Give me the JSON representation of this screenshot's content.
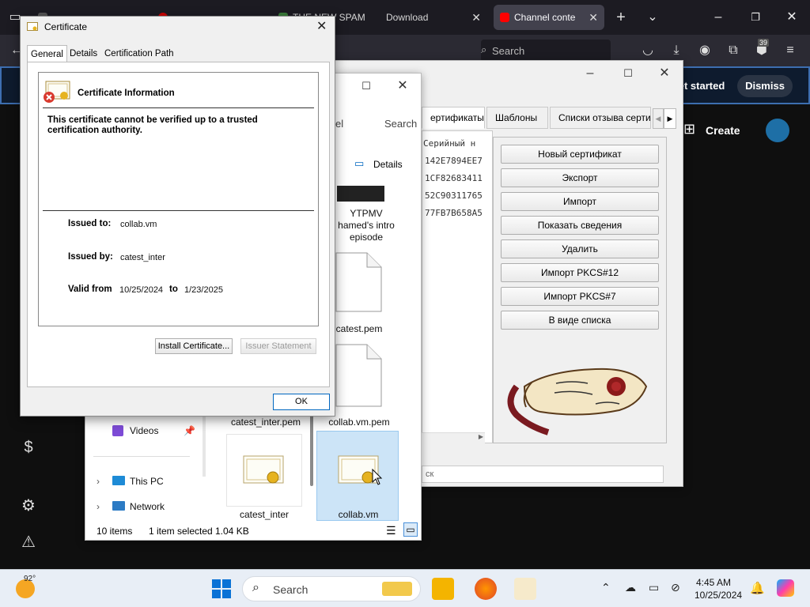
{
  "browser": {
    "tabs": [
      {
        "label": "",
        "active": false
      },
      {
        "label": "",
        "active": false
      },
      {
        "label": "THE NEW SPAM",
        "active": false
      },
      {
        "label": "Download",
        "active": false
      },
      {
        "label": "Channel conte",
        "active": true
      }
    ],
    "search_placeholder": "Search",
    "badge_count": "39"
  },
  "youtube": {
    "get_started_label": "et started",
    "dismiss_label": "Dismiss",
    "create_label": "Create"
  },
  "cert_manager": {
    "tabs": [
      "ертификаты",
      "Шаблоны",
      "Списки отзыва сертис"
    ],
    "serial_header": "Серийный н",
    "serials": [
      "142E7894EE7",
      "1CF82683411",
      "52C90311765",
      "77FB7B658A5"
    ],
    "buttons": [
      {
        "label": "Новый сертификат",
        "mnemonic": "Н"
      },
      {
        "label": "Экспорт",
        "mnemonic": "Э"
      },
      {
        "label": "Импорт",
        "mnemonic": "И"
      },
      {
        "label": "Показать сведения",
        "mnemonic": "П"
      },
      {
        "label": "Удалить",
        "mnemonic": "У"
      },
      {
        "label": "Импорт PKCS#12",
        "mnemonic": "P"
      },
      {
        "label": "Импорт PKCS#7",
        "mnemonic": "K"
      },
      {
        "label": "В виде списка",
        "mnemonic": "В"
      }
    ],
    "bottom_input_text": "ск"
  },
  "explorer": {
    "search_label": "Search",
    "partial_text": "el",
    "details_label": "Details",
    "items": [
      {
        "name": "YTPMV\nhamed's intro\nepisode"
      },
      {
        "name": "catest.pem"
      },
      {
        "name": "catest_inter.pem"
      },
      {
        "name": "collab.vm.pem"
      },
      {
        "name": "catest_inter"
      },
      {
        "name": "collab.vm"
      }
    ],
    "nav": [
      {
        "label": "Videos"
      },
      {
        "label": "This PC"
      },
      {
        "label": "Network"
      }
    ],
    "status": {
      "items": "10 items",
      "selected": "1 item selected",
      "size": "1.04 KB"
    }
  },
  "certificate_dialog": {
    "title": "Certificate",
    "tabs": [
      "General",
      "Details",
      "Certification Path"
    ],
    "info_heading": "Certificate Information",
    "warning": "This certificate cannot be verified up to a trusted certification authority.",
    "issued_to_label": "Issued to:",
    "issued_to_value": "collab.vm",
    "issued_by_label": "Issued by:",
    "issued_by_value": "catest_inter",
    "valid_from_label": "Valid from",
    "valid_from_value": "10/25/2024",
    "valid_to_label": "to",
    "valid_to_value": "1/23/2025",
    "install_button": "Install Certificate...",
    "issuer_statement_button": "Issuer Statement",
    "ok_button": "OK"
  },
  "taskbar": {
    "weather_temp": "92°",
    "search_placeholder": "Search",
    "time": "4:45 AM",
    "date": "10/25/2024"
  },
  "colors": {
    "accent_blue": "#3d6eb0",
    "selection": "#cce4f7",
    "youtube_red": "#ff0000"
  }
}
